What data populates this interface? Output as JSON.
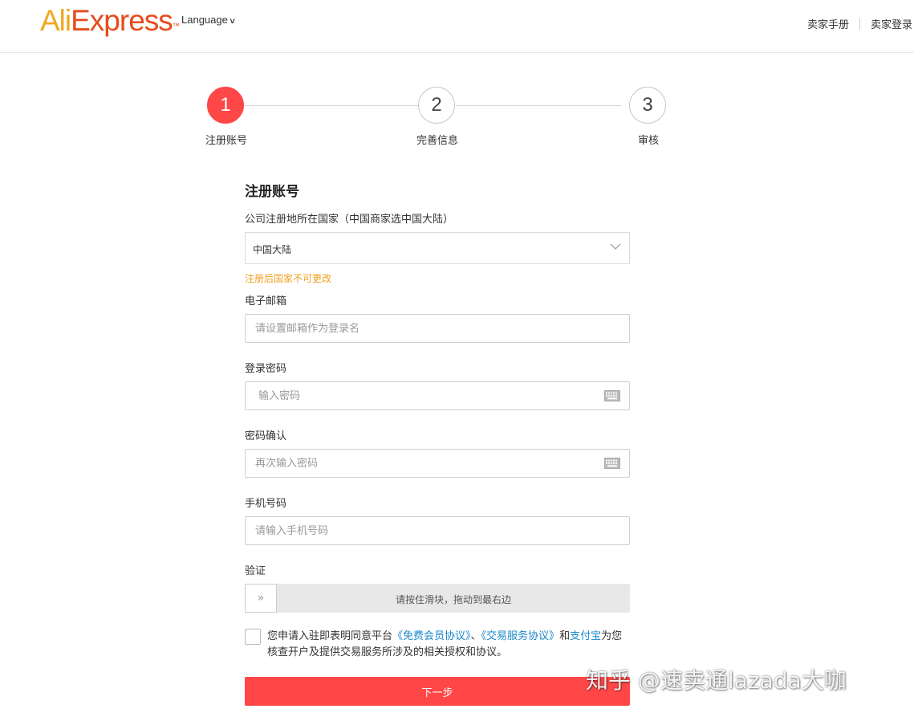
{
  "header": {
    "logo": {
      "ali": "Ali",
      "express": "Express",
      "tm": "™"
    },
    "language_label": "Language",
    "links": [
      "卖家手册",
      "卖家登录"
    ]
  },
  "stepper": {
    "steps": [
      {
        "number": "1",
        "label": "注册账号",
        "state": "active"
      },
      {
        "number": "2",
        "label": "完善信息",
        "state": "pending"
      },
      {
        "number": "3",
        "label": "审核",
        "state": "pending"
      }
    ],
    "active_color": "#ff4747"
  },
  "form": {
    "title": "注册账号",
    "country": {
      "label": "公司注册地所在国家（中国商家选中国大陆）",
      "value": "中国大陆",
      "hint": "注册后国家不可更改"
    },
    "email": {
      "label": "电子邮箱",
      "placeholder": "请设置邮箱作为登录名"
    },
    "password": {
      "label": "登录密码",
      "placeholder": "输入密码",
      "icon": "keyboard-icon"
    },
    "confirm": {
      "label": "密码确认",
      "placeholder": "再次输入密码",
      "icon": "keyboard-icon"
    },
    "phone": {
      "label": "手机号码",
      "placeholder": "请输入手机号码"
    },
    "verify": {
      "label": "验证",
      "handle": "»",
      "text": "请按住滑块，拖动到最右边"
    },
    "agreement": {
      "prefix": "您申请入驻即表明同意平台",
      "link1": "《免费会员协议》",
      "sep": "、",
      "link2": "《交易服务协议》",
      "and": "和",
      "link3": "支付宝",
      "suffix": "为您核查开户及提供交易服务所涉及的相关授权和协议。"
    },
    "next_button": "下一步"
  },
  "watermark": "知乎 @速卖通lazada大咖",
  "colors": {
    "accent": "#ff4747",
    "link": "#1a88c9",
    "hint": "#f0a020"
  }
}
